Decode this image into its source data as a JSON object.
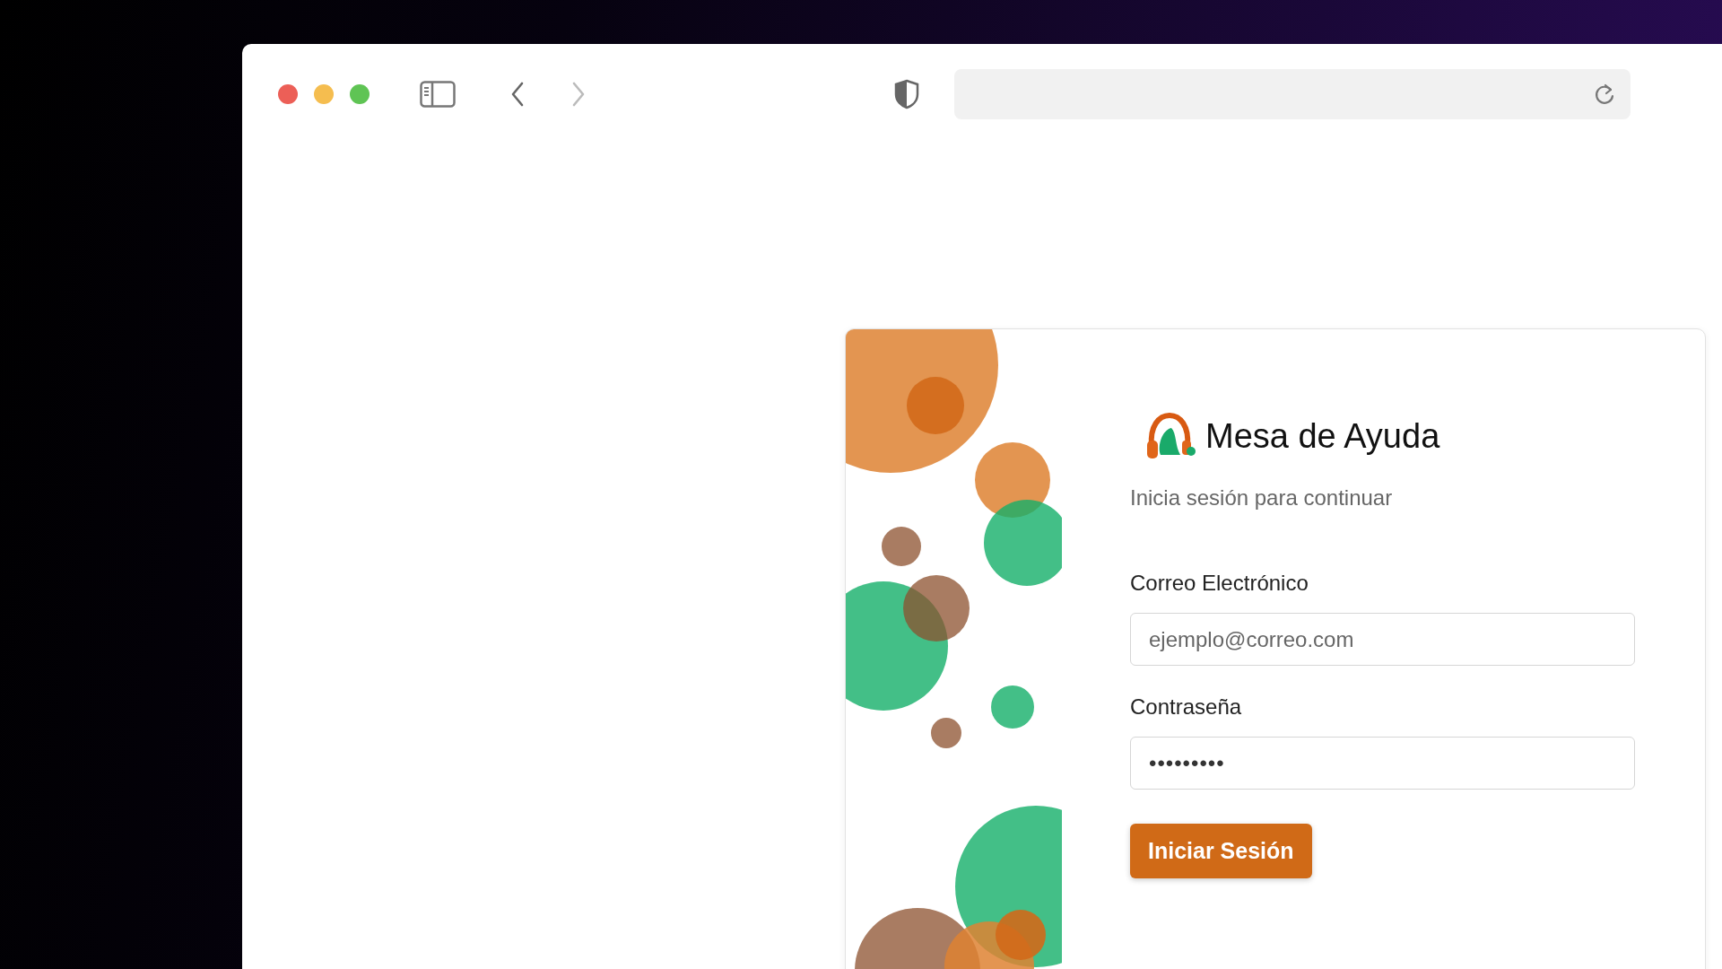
{
  "browser": {
    "navigation": [
      {
        "kind": "back",
        "disabled": false
      },
      {
        "kind": "forward",
        "disabled": true
      }
    ]
  },
  "login": {
    "title": "Mesa de Ayuda",
    "subtitle": "Inicia sesión para continuar",
    "fields": [
      {
        "label": "Correo Electrónico",
        "placeholder": "ejemplo@correo.com"
      },
      {
        "label": "Contraseña",
        "value": "•••••••••"
      }
    ],
    "submit": "Iniciar Sesión"
  }
}
